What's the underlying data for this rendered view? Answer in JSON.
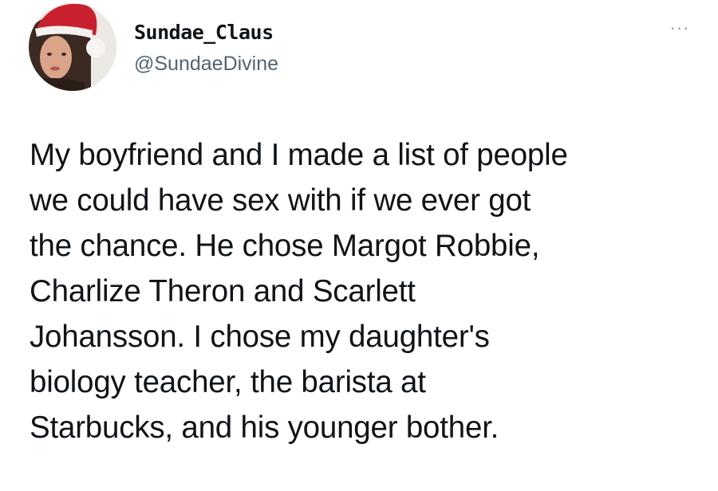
{
  "tweet": {
    "author": {
      "display_name": "Sundae_Claus",
      "handle": "@SundaeDivine",
      "avatar": "profile-photo-with-santa-hat"
    },
    "more_icon": "more-horizontal-icon",
    "more_glyph": "···",
    "text_lines": [
      "My boyfriend and I made a list of people",
      "we could have sex with if we ever got",
      "the chance. He chose Margot Robbie,",
      "Charlize Theron and Scarlett",
      "Johansson. I chose my daughter's",
      "biology teacher, the barista at",
      "Starbucks, and his younger bother."
    ]
  },
  "colors": {
    "text": "#0f1419",
    "secondary": "#536471",
    "background": "#ffffff",
    "hat_red": "#c8202f"
  }
}
